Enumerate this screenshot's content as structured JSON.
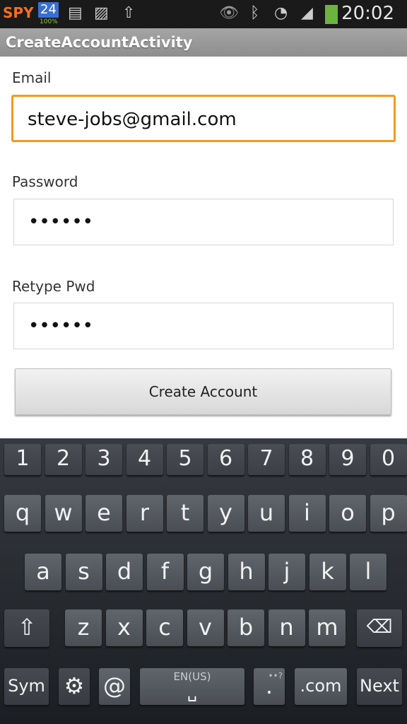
{
  "status_bar": {
    "time": "20:02",
    "app_badge": "24",
    "battery_level": "100%",
    "icons": [
      "spy24-logo",
      "sim-icon",
      "gallery-icon",
      "upload-icon",
      "eye-icon",
      "bluetooth-icon",
      "wifi-icon",
      "signal-icon",
      "battery-icon"
    ]
  },
  "app_bar": {
    "title": "CreateAccountActivity"
  },
  "form": {
    "email_label": "Email",
    "email_value": "steve-jobs@gmail.com",
    "password_label": "Password",
    "password_value": "••••••",
    "retype_label": "Retype Pwd",
    "retype_value": "••••••",
    "submit_label": "Create Account"
  },
  "colors": {
    "focus_border": "#f29a1f",
    "keyboard_bg": "#2a2d32"
  },
  "keyboard": {
    "numbers": [
      "1",
      "2",
      "3",
      "4",
      "5",
      "6",
      "7",
      "8",
      "9",
      "0"
    ],
    "row1": [
      "q",
      "w",
      "e",
      "r",
      "t",
      "y",
      "u",
      "i",
      "o",
      "p"
    ],
    "row2": [
      "a",
      "s",
      "d",
      "f",
      "g",
      "h",
      "j",
      "k",
      "l"
    ],
    "row3": [
      "z",
      "x",
      "c",
      "v",
      "b",
      "n",
      "m"
    ],
    "sym": "Sym",
    "at": "@",
    "space_lang": "EN(US)",
    "dot": ".",
    "dot_hint": "••?",
    "com": ".com",
    "next": "Next"
  }
}
